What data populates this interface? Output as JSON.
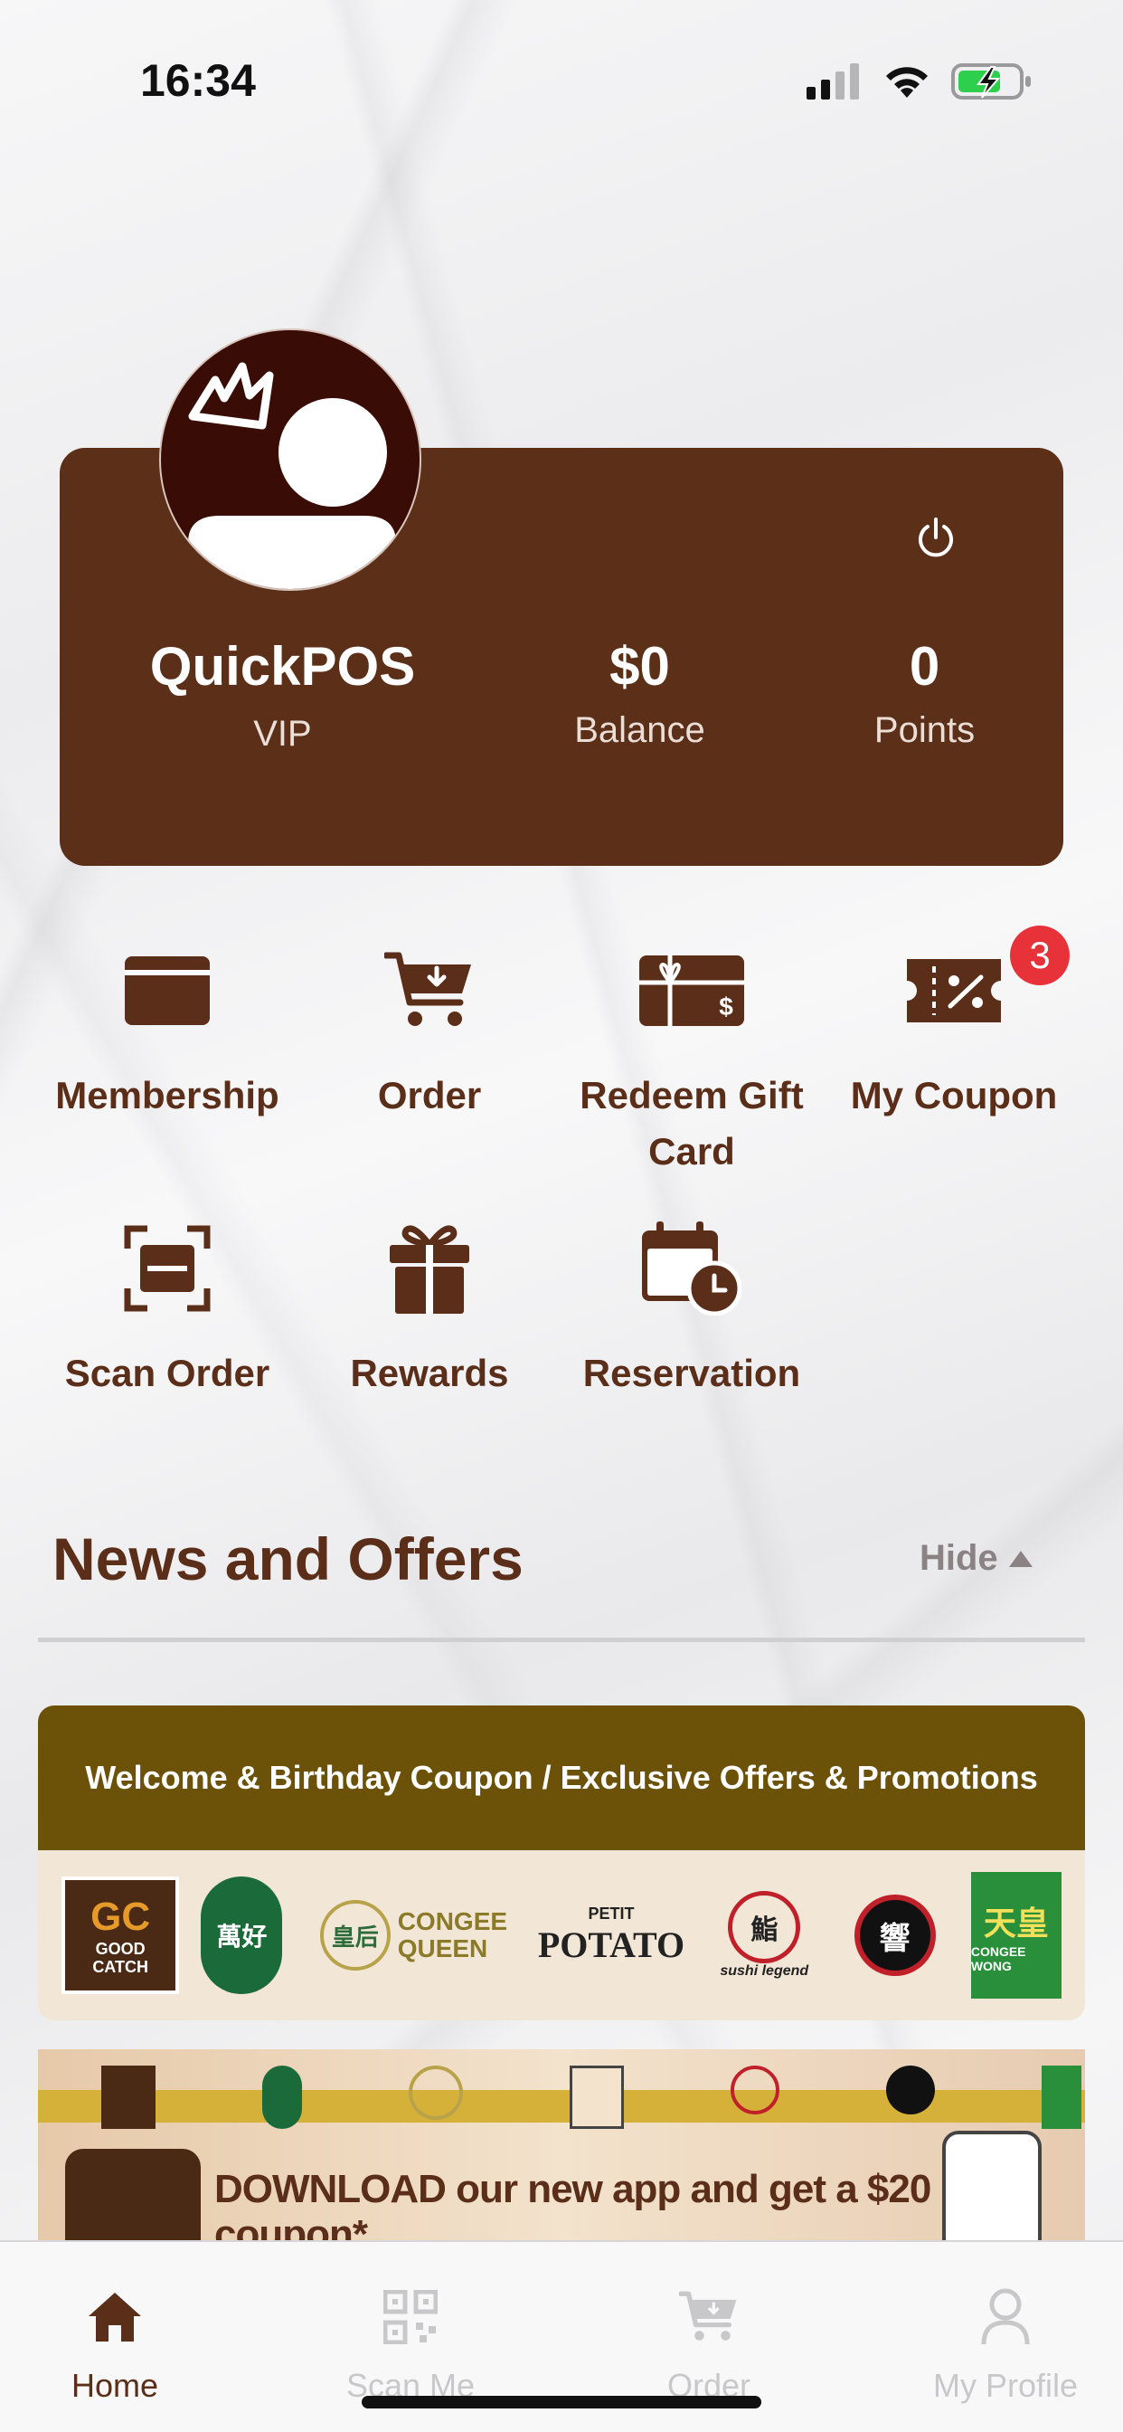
{
  "status_bar": {
    "time": "16:34"
  },
  "profile": {
    "name": "QuickPOS",
    "tier": "VIP",
    "balance_value": "$0",
    "balance_label": "Balance",
    "points_value": "0",
    "points_label": "Points"
  },
  "actions": [
    {
      "label": "Membership",
      "icon": "card-icon"
    },
    {
      "label": "Order",
      "icon": "cart-icon"
    },
    {
      "label": "Redeem Gift Card",
      "icon": "gift-card-icon"
    },
    {
      "label": "My Coupon",
      "icon": "coupon-icon",
      "badge": "3"
    },
    {
      "label": "Scan Order",
      "icon": "scan-icon"
    },
    {
      "label": "Rewards",
      "icon": "gift-icon"
    },
    {
      "label": "Reservation",
      "icon": "calendar-clock-icon"
    }
  ],
  "news": {
    "title": "News and Offers",
    "hide_label": "Hide"
  },
  "banners": {
    "banner1_heading": "Welcome & Birthday Coupon / Exclusive Offers & Promotions",
    "brands": {
      "good_catch": "GOOD CATCH",
      "congee_queen": "CONGEE QUEEN",
      "petit_potato": "POTATO",
      "petit_word": "PETIT",
      "sushi_legend": "sushi legend",
      "congee_wong": "CONGEE WONG"
    },
    "banner2_text": "DOWNLOAD our new app and get a $20 coupon*"
  },
  "tabs": [
    {
      "label": "Home",
      "icon": "home-icon",
      "active": true
    },
    {
      "label": "Scan Me",
      "icon": "qr-icon",
      "active": false
    },
    {
      "label": "Order",
      "icon": "cart-icon",
      "active": false
    },
    {
      "label": "My Profile",
      "icon": "person-icon",
      "active": false
    }
  ],
  "colors": {
    "brand_brown": "#5b2f18",
    "banner_gold": "#6b5208",
    "badge_red": "#e8323a",
    "inactive_tab": "#c8c8cb"
  }
}
